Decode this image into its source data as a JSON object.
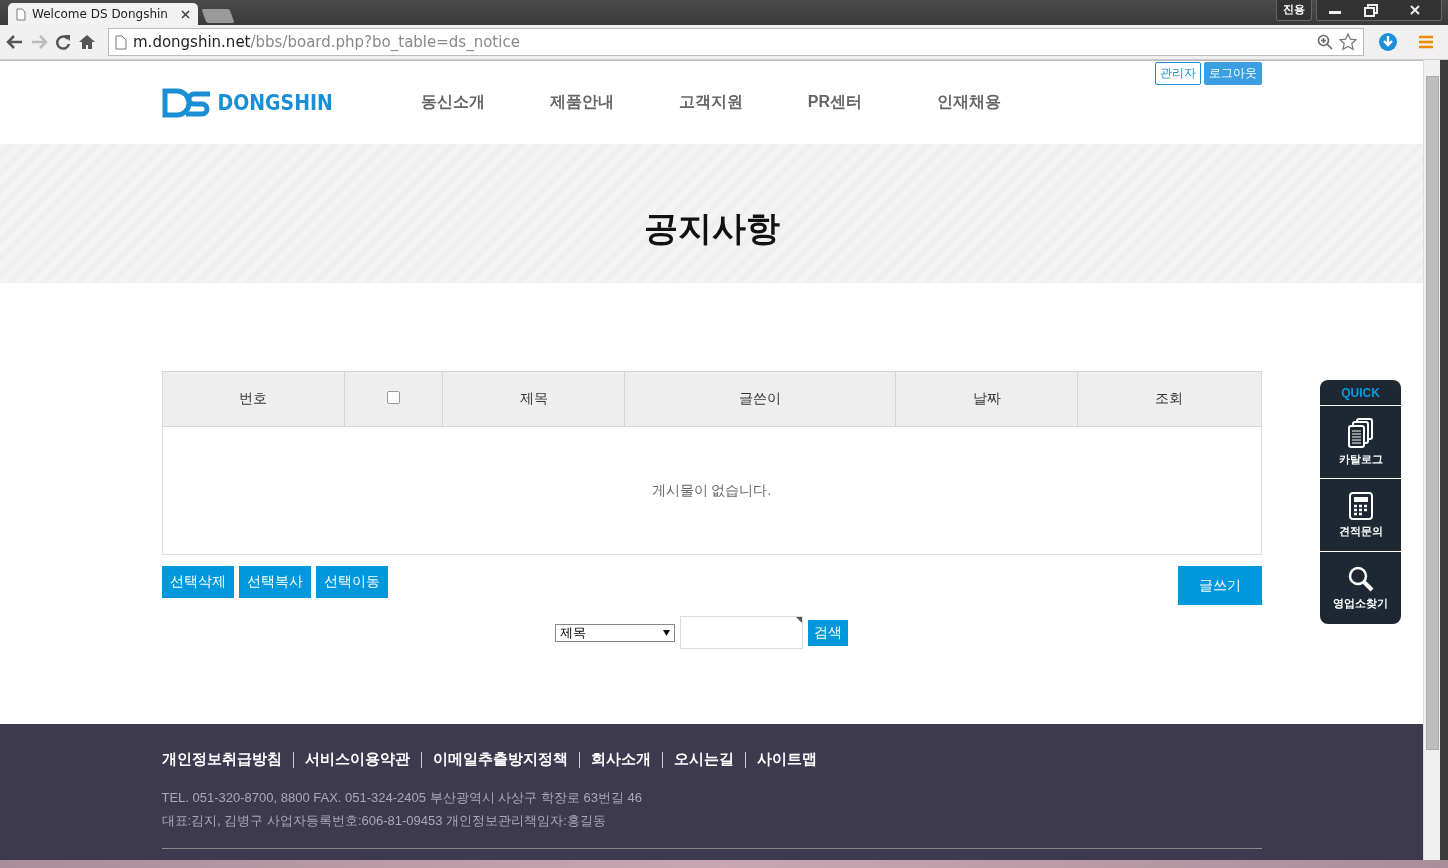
{
  "browser": {
    "tab_title": "Welcome DS Dongshin",
    "url_host": "m.dongshin.net",
    "url_path": "/bbs/board.php?bo_table=ds_notice",
    "ime_label": "진용"
  },
  "header": {
    "logo_text": "DONGSHIN",
    "admin_links": [
      {
        "label": "관리자",
        "kind": "outline"
      },
      {
        "label": "로그아웃",
        "kind": "filled"
      }
    ],
    "nav": [
      "동신소개",
      "제품안내",
      "고객지원",
      "PR센터",
      "인재채용"
    ]
  },
  "page_title": "공지사항",
  "board": {
    "columns": [
      {
        "kind": "text",
        "label": "번호"
      },
      {
        "kind": "checkbox",
        "checked": false
      },
      {
        "kind": "text",
        "label": "제목"
      },
      {
        "kind": "text",
        "label": "글쓴이"
      },
      {
        "kind": "text",
        "label": "날짜"
      },
      {
        "kind": "text",
        "label": "조회"
      }
    ],
    "empty_message": "게시물이 없습니다.",
    "actions": [
      "선택삭제",
      "선택복사",
      "선택이동"
    ],
    "write_button": "글쓰기",
    "search": {
      "field": "제목",
      "button": "검색"
    }
  },
  "quick": {
    "title": "QUICK",
    "items": [
      {
        "kind": "catalog",
        "label": "카탈로그"
      },
      {
        "kind": "calculator",
        "label": "견적문의"
      },
      {
        "kind": "search",
        "label": "영업소찾기"
      }
    ]
  },
  "footer": {
    "links": [
      "개인정보취급방침",
      "서비스이용약관",
      "이메일추출방지정책",
      "회사소개",
      "오시는길",
      "사이트맵"
    ],
    "lines": [
      "TEL. 051-320-8700, 8800 FAX. 051-324-2405 부산광역시 사상구 학장로 63번길 46",
      "대표:김지, 김병구 사업자등록번호:606-81-09453 개인정보관리책임자:홍길동"
    ]
  }
}
